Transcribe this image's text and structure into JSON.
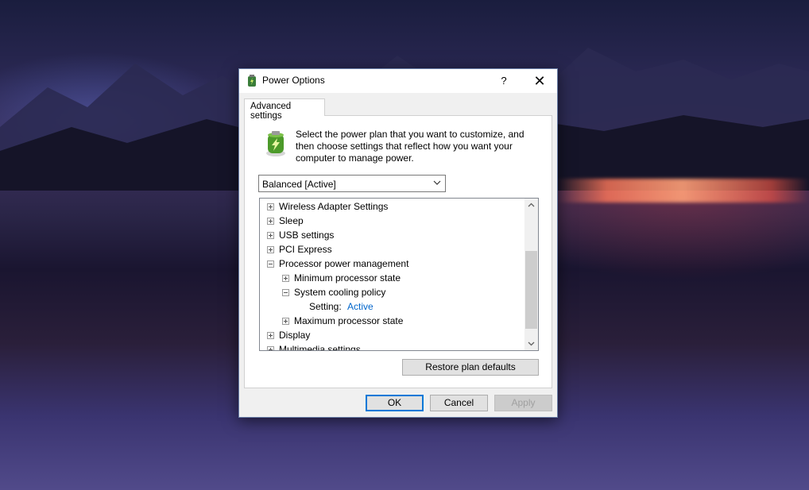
{
  "window": {
    "title": "Power Options",
    "help_label": "?",
    "close_label": "✕"
  },
  "tabs": [
    {
      "label": "Advanced settings",
      "selected": true
    }
  ],
  "description": "Select the power plan that you want to customize, and then choose settings that reflect how you want your computer to manage power.",
  "plan_select": {
    "value": "Balanced [Active]"
  },
  "tree": {
    "items": [
      {
        "label": "Wireless Adapter Settings",
        "state": "collapsed",
        "level": 0
      },
      {
        "label": "Sleep",
        "state": "collapsed",
        "level": 0
      },
      {
        "label": "USB settings",
        "state": "collapsed",
        "level": 0
      },
      {
        "label": "PCI Express",
        "state": "collapsed",
        "level": 0
      },
      {
        "label": "Processor power management",
        "state": "expanded",
        "level": 0
      },
      {
        "label": "Minimum processor state",
        "state": "collapsed",
        "level": 1
      },
      {
        "label": "System cooling policy",
        "state": "expanded",
        "level": 1
      },
      {
        "label": "Setting:",
        "value": "Active",
        "state": "leaf",
        "level": 2
      },
      {
        "label": "Maximum processor state",
        "state": "collapsed",
        "level": 1
      },
      {
        "label": "Display",
        "state": "collapsed",
        "level": 0
      },
      {
        "label": "Multimedia settings",
        "state": "collapsed",
        "level": 0
      }
    ]
  },
  "buttons": {
    "restore": "Restore plan defaults",
    "ok": "OK",
    "cancel": "Cancel",
    "apply": "Apply"
  },
  "colors": {
    "accent": "#0078d7",
    "link": "#0066cc"
  }
}
